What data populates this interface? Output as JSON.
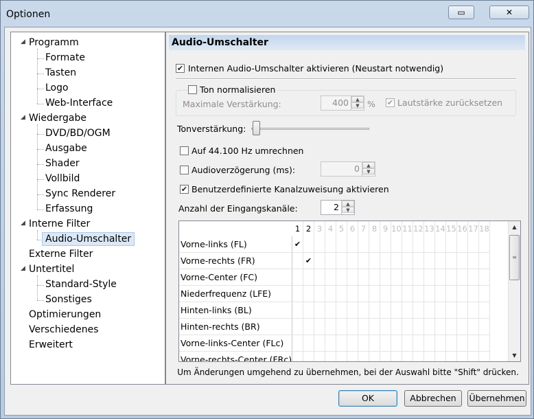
{
  "window": {
    "title": "Optionen",
    "close_glyph": "✕",
    "restore_glyph": "▭"
  },
  "tree": {
    "items": [
      {
        "label": "Programm",
        "level": 0,
        "expanded": true
      },
      {
        "label": "Formate",
        "level": 1
      },
      {
        "label": "Tasten",
        "level": 1
      },
      {
        "label": "Logo",
        "level": 1
      },
      {
        "label": "Web-Interface",
        "level": 1
      },
      {
        "label": "Wiedergabe",
        "level": 0,
        "expanded": true
      },
      {
        "label": "DVD/BD/OGM",
        "level": 1
      },
      {
        "label": "Ausgabe",
        "level": 1
      },
      {
        "label": "Shader",
        "level": 1
      },
      {
        "label": "Vollbild",
        "level": 1
      },
      {
        "label": "Sync Renderer",
        "level": 1
      },
      {
        "label": "Erfassung",
        "level": 1
      },
      {
        "label": "Interne Filter",
        "level": 0,
        "expanded": true
      },
      {
        "label": "Audio-Umschalter",
        "level": 1,
        "selected": true
      },
      {
        "label": "Externe Filter",
        "level": 0
      },
      {
        "label": "Untertitel",
        "level": 0,
        "expanded": true
      },
      {
        "label": "Standard-Style",
        "level": 1
      },
      {
        "label": "Sonstiges",
        "level": 1
      },
      {
        "label": "Optimierungen",
        "level": 0
      },
      {
        "label": "Verschiedenes",
        "level": 0
      },
      {
        "label": "Erweitert",
        "level": 0
      }
    ]
  },
  "panel": {
    "title": "Audio-Umschalter",
    "enable_switcher": {
      "label": "Internen Audio-Umschalter aktivieren (Neustart notwendig)",
      "checked": true
    },
    "normalize": {
      "label": "Ton normalisieren",
      "checked": false
    },
    "max_gain": {
      "label": "Maximale Verstärkung:",
      "value": "400",
      "unit": "%"
    },
    "reset_volume": {
      "label": "Lautstärke zurücksetzen",
      "checked": true
    },
    "boost": {
      "label": "Tonverstärkung:",
      "level": 0
    },
    "resample": {
      "label": "Auf 44.100 Hz umrechnen",
      "checked": false
    },
    "delay": {
      "label": "Audioverzögerung (ms):",
      "checked": false,
      "value": "0"
    },
    "custom_mapping": {
      "label": "Benutzerdefinierte Kanalzuweisung aktivieren",
      "checked": true
    },
    "input_channels": {
      "label": "Anzahl der Eingangskanäle:",
      "value": "2"
    },
    "grid": {
      "columns": [
        "1",
        "2",
        "3",
        "4",
        "5",
        "6",
        "7",
        "8",
        "9",
        "10",
        "11",
        "12",
        "13",
        "14",
        "15",
        "16",
        "17",
        "18"
      ],
      "active_columns": 2,
      "rows": [
        {
          "label": "Vorne-links (FL)",
          "checks": [
            1
          ]
        },
        {
          "label": "Vorne-rechts (FR)",
          "checks": [
            2
          ]
        },
        {
          "label": "Vorne-Center (FC)",
          "checks": []
        },
        {
          "label": "Niederfrequenz (LFE)",
          "checks": []
        },
        {
          "label": "Hinten-links (BL)",
          "checks": []
        },
        {
          "label": "Hinten-rechts (BR)",
          "checks": []
        },
        {
          "label": "Vorne-links-Center (FLc)",
          "checks": []
        },
        {
          "label": "Vorne-rechts-Center (FRc)",
          "checks": []
        }
      ],
      "check_glyph": "✔"
    },
    "hint": "Um Änderungen umgehend zu übernehmen, bei der Auswahl bitte \"Shift\" drücken."
  },
  "buttons": {
    "ok": "OK",
    "cancel": "Abbrechen",
    "apply": "Übernehmen"
  },
  "colors": {
    "header_bg": "#c2d6ee",
    "selection_bg": "#dbe8f6",
    "frame": "#b7cbe2"
  }
}
